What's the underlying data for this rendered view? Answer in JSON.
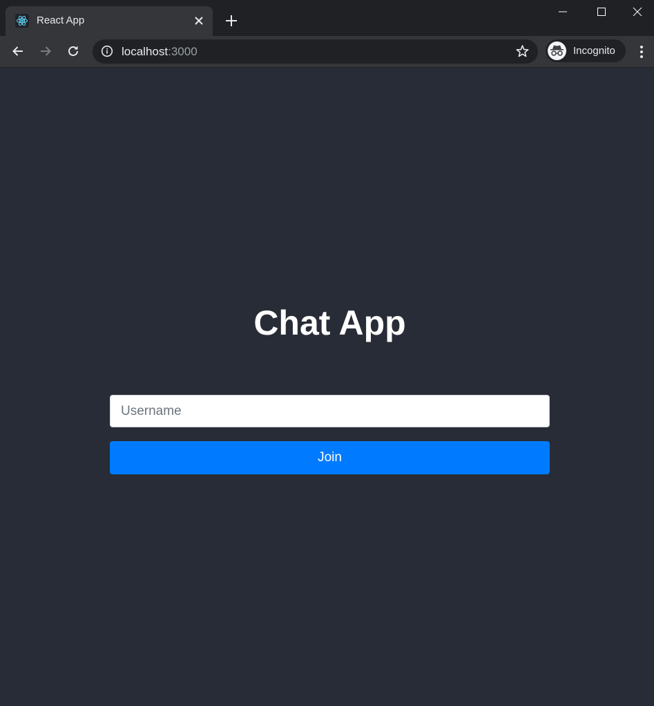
{
  "browser": {
    "tab": {
      "title": "React App",
      "favicon": "react-logo-icon"
    },
    "address_bar": {
      "host": "localhost",
      "port": ":3000"
    },
    "profile": {
      "label": "Incognito",
      "icon": "incognito-icon"
    }
  },
  "page": {
    "title": "Chat App",
    "username_input": {
      "placeholder": "Username",
      "value": ""
    },
    "join_button": {
      "label": "Join"
    }
  },
  "colors": {
    "page_background": "#282c36",
    "button_primary": "#007bff",
    "tab_strip": "#202124",
    "toolbar": "#35363a"
  }
}
